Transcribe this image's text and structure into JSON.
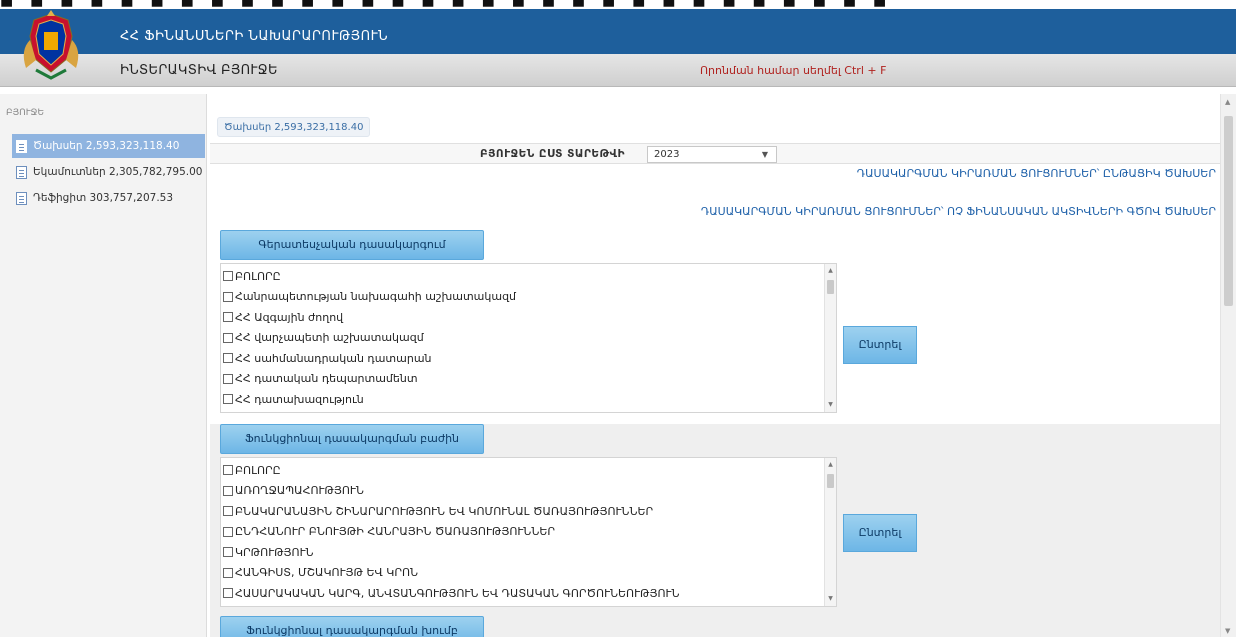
{
  "header": {
    "ministry_title": "ՀՀ ՖԻՆԱՆՍՆԵՐԻ ՆԱԽԱՐԱՐՈՒԹՅՈՒՆ",
    "budget_title": "ԻՆՏԵՐԱԿՏԻՎ ԲՅՈՒՋԵ",
    "search_hint": "Որոնման համար սեղմել Ctrl + F"
  },
  "sidebar": {
    "label": "ԲՅՈՒՋԵ",
    "items": [
      {
        "label": "Ծախսեր 2,593,323,118.40",
        "selected": true
      },
      {
        "label": "Եկամուտներ 2,305,782,795.00",
        "selected": false
      },
      {
        "label": "Դեֆիցիտ 303,757,207.53",
        "selected": false
      }
    ]
  },
  "main": {
    "breadcrumb": "Ծախսեր 2,593,323,118.40",
    "year_label": "ԲՅՈՒՋԵՆ ԸՍՏ ՏԱՐԵԹՎԻ",
    "year_value": "2023",
    "link_1": "ԴԱՍԱԿԱՐԳՄԱՆ ԿԻՐԱՌՄԱՆ ՑՈՒՑՈՒՄՆԵՐ՝ ԸՆԹԱՑԻԿ ԾԱԽՍԵՐ",
    "link_2": "ԴԱՍԱԿԱՐԳՄԱՆ ԿԻՐԱՌՄԱՆ ՑՈՒՑՈՒՄՆԵՐ՝ ՈՉ ՖԻՆԱՆՍԱԿԱՆ ԱԿՏԻՎՆԵՐԻ ԳԾՈՎ ԾԱԽՍԵՐ",
    "section1": {
      "button": "Գերատեսչական դասակարգում",
      "items": [
        "ԲՈԼՈՐԸ",
        "Հանրապետության նախագահի աշխատակազմ",
        "ՀՀ Ազգային ժողով",
        "ՀՀ վարչապետի աշխատակազմ",
        "ՀՀ սահմանադրական դատարան",
        "ՀՀ դատական դեպարտամենտ",
        "ՀՀ դատախազություն"
      ],
      "select_button": "Ընտրել"
    },
    "section2": {
      "button": "Ֆունկցիոնալ դասակարգման բաժին",
      "items": [
        "ԲՈԼՈՐԸ",
        "ԱՌՈՂՋԱՊԱՀՈՒԹՅՈՒՆ",
        "ԲՆԱԿԱՐԱՆԱՅԻՆ ՇԻՆԱՐԱՐՈՒԹՅՈՒՆ ԵՎ ԿՈՄՈՒՆԱԼ ԾԱՌԱՅՈՒԹՅՈՒՆՆԵՐ",
        "ԸՆԴՀԱՆՈՒՐ ԲՆՈՒՅԹԻ ՀԱՆՐԱՅԻՆ ԾԱՌԱՅՈՒԹՅՈՒՆՆԵՐ",
        "ԿՐԹՈՒԹՅՈՒՆ",
        "ՀԱՆԳԻՍՏ, ՄՇԱԿՈՒՅԹ ԵՎ ԿՐՈՆ",
        "ՀԱՍԱՐԱԿԱԿԱՆ ԿԱՐԳ, ԱՆՎՏԱՆԳՈՒԹՅՈՒՆ ԵՎ ԴԱՏԱԿԱՆ ԳՈՐԾՈՒՆԵՈՒԹՅՈՒՆ"
      ],
      "select_button": "Ընտրել"
    },
    "section3": {
      "button": "Ֆունկցիոնալ դասակարգման խումբ"
    }
  }
}
